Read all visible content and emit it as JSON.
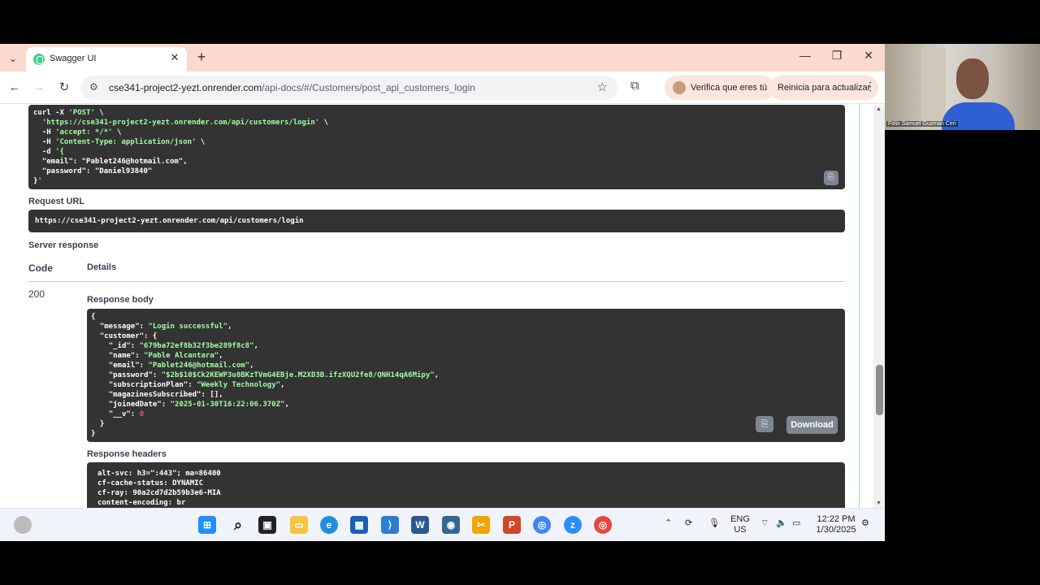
{
  "browser": {
    "tab_title": "Swagger UI",
    "url_host": "cse341-project2-yezt.onrender.com",
    "url_path": "/api-docs/#/Customers/post_api_customers_login",
    "profile_pill": "Verifica que eres tú",
    "update_pill": "Reinicia para actualizar"
  },
  "curl": {
    "lines": [
      "curl -X 'POST' \\",
      "  'https://cse341-project2-yezt.onrender.com/api/customers/login' \\",
      "  -H 'accept: */*' \\",
      "  -H 'Content-Type: application/json' \\",
      "  -d '{",
      "  \"email\": \"Pablet246@hotmail.com\",",
      "  \"password\": \"Daniel93840\"",
      "}'"
    ]
  },
  "request_url": {
    "label": "Request URL",
    "value": "https://cse341-project2-yezt.onrender.com/api/customers/login"
  },
  "server_response": {
    "label": "Server response",
    "code_header": "Code",
    "details_header": "Details",
    "code": "200",
    "body_label": "Response body",
    "body_lines": [
      "{",
      "  \"message\": \"Login successful\",",
      "  \"customer\": {",
      "    \"_id\": \"679ba72ef8b32f3be289f8c8\",",
      "    \"name\": \"Pable Alcantara\",",
      "    \"email\": \"Pablet246@hotmail.com\",",
      "    \"password\": \"$2b$10$Ck2KEWP3u8BKzTVmG4EBje.M2XD3B.ifzXQU2fe8/QNH14qA6Mipy\",",
      "    \"subscriptionPlan\": \"Weekly Technology\",",
      "    \"magazinesSubscribed\": [],",
      "    \"joinedDate\": \"2025-01-30T16:22:06.370Z\",",
      "    \"__v\": 0",
      "  }",
      "}"
    ],
    "download_label": "Download",
    "headers_label": "Response headers",
    "header_lines": [
      "alt-svc: h3=\":443\"; ma=86400",
      "cf-cache-status: DYNAMIC",
      "cf-ray: 90a2cd7d2b59b3e6-MIA",
      "content-encoding: br"
    ]
  },
  "taskbar": {
    "lang_top": "ENG",
    "lang_bottom": "US",
    "time": "12:22 PM",
    "date": "1/30/2025"
  },
  "webcam": {
    "name": "Felix Samuel Guzman Ceri"
  },
  "colors": {
    "tab_bar": "#fbd9cf",
    "code_bg": "#333333",
    "string": "#a2fca2",
    "swagger_green": "#49cc90"
  }
}
